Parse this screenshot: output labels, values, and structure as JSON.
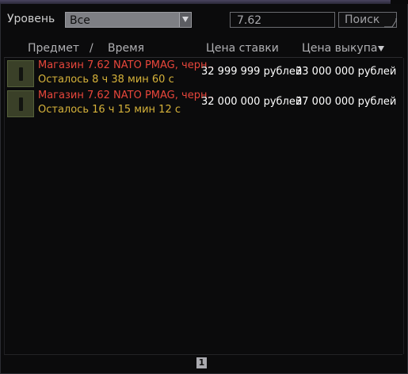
{
  "filters": {
    "level_label": "Уровень",
    "level_value": "Все",
    "search_value": "7.62",
    "search_button": "Поиск"
  },
  "table": {
    "columns": {
      "item": "Предмет",
      "separator": "/",
      "time": "Время",
      "bid": "Цена ставки",
      "buyout": "Цена выкупа"
    },
    "sort_icon": "triangle-down-icon",
    "rows": [
      {
        "name": "Магазин 7.62 NATO PMAG, черн..",
        "remaining": "Осталось 8 ч 38 мин 60 с",
        "bid": "32 999 999 рублей",
        "buyout": "33 000 000 рублей",
        "icon": "magazine-icon"
      },
      {
        "name": "Магазин 7.62 NATO PMAG, черн..",
        "remaining": "Осталось 16 ч 15 мин 12 с",
        "bid": "32 000 000 рублей",
        "buyout": "37 000 000 рублей",
        "icon": "magazine-icon"
      }
    ]
  },
  "pagination": {
    "current_page": "1"
  },
  "colors": {
    "item_name": "#e8463b",
    "time_remaining": "#d6b23a",
    "price": "#ffffff",
    "background": "#0b0b0c"
  }
}
